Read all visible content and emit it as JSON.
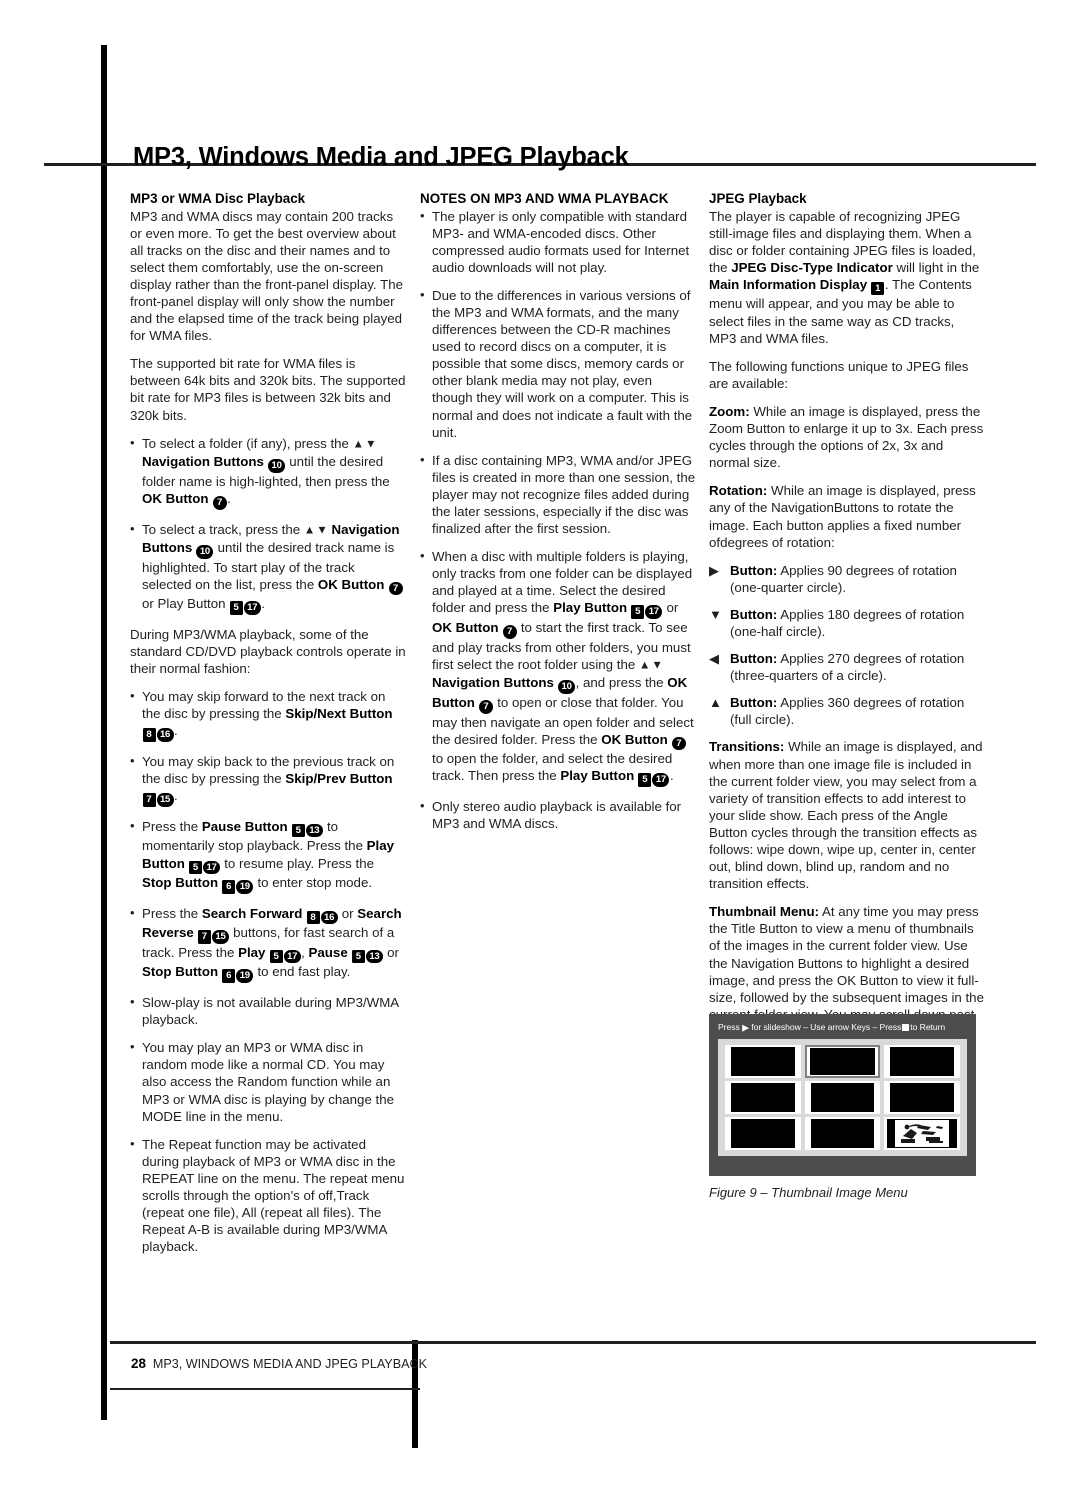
{
  "page": {
    "title": "MP3, Windows Media and JPEG Playback",
    "footer_page_number": "28",
    "footer_section": "MP3, WINDOWS MEDIA AND JPEG PLAYBACK"
  },
  "column1": {
    "heading": "MP3 or WMA Disc Playback",
    "p1": "MP3 and WMA discs may contain 200 tracks or even more. To get the best overview about all tracks on the disc and their names and to select them comfortably, use the on-screen display rather than the front-panel display. The front-panel display will only show the number and the elapsed time of the track being played for WMA files.",
    "p2": "The supported bit rate for WMA files is between 64k bits and 320k bits. The supported bit rate for MP3 files is between 32k bits and 320k bits.",
    "bullet1_a": "To select a folder (if any), press the ",
    "bullet1_b": "Navigation Buttons",
    "bullet1_c": " until the desired folder name is high-lighted, then press the ",
    "bullet1_d": "OK Button",
    "bullet1_e": ".",
    "bullet2_a": "To select a track, press the ",
    "bullet2_b": "Navigation Buttons",
    "bullet2_c": " until the desired track name is highlighted. To start play of the track selected on the list, press the ",
    "bullet2_d": "OK Button",
    "bullet2_e": " or Play Button ",
    "bullet2_f": ".",
    "p3": "During MP3/WMA playback, some of the standard CD/DVD playback controls operate in their normal fashion:",
    "bullet3_a": "You may skip forward to the next track on the disc by pressing the ",
    "bullet3_b": "Skip/Next Button",
    "bullet3_c": ".",
    "bullet4_a": "You may skip back to the previous track on the disc by pressing the ",
    "bullet4_b": "Skip/Prev Button",
    "bullet4_c": ".",
    "bullet5_a": "Press the ",
    "bullet5_b": "Pause Button",
    "bullet5_c": " to momentarily stop playback. Press the ",
    "bullet5_d": "Play Button",
    "bullet5_e": " to resume play. Press the ",
    "bullet5_f": "Stop Button",
    "bullet5_g": " to enter stop mode.",
    "bullet6_a": "Press the ",
    "bullet6_b": "Search Forward",
    "bullet6_c": " or ",
    "bullet6_d": "Search Reverse",
    "bullet6_e": " buttons, for fast search of a track. Press the ",
    "bullet6_f": "Play",
    "bullet6_g": ", ",
    "bullet6_h": "Pause",
    "bullet6_i": " or ",
    "bullet6_j": "Stop Button",
    "bullet6_k": " to end fast play.",
    "bullet7": "Slow-play is not available during MP3/WMA playback.",
    "bullet8": "You may play an MP3 or WMA disc in random mode like a normal CD. You may also access the Random function while an MP3 or WMA disc is playing by change the MODE line in the menu.",
    "bullet9_line1": "The Repeat function may be activated during playback of MP3 or WMA disc in the REPEAT line on the menu.",
    "bullet9_line2": "The repeat menu scrolls through the option's of off,Track (repeat one file), All (repeat all files).",
    "bullet9_line3": "The Repeat A-B is available during MP3/WMA playback."
  },
  "column2": {
    "heading": "NOTES ON MP3 AND WMA PLAYBACK",
    "bullet1": "The player is only compatible with standard MP3- and WMA-encoded discs. Other compressed audio formats used for Internet audio downloads will not play.",
    "bullet2": "Due to the differences in various versions of the MP3 and WMA formats, and the many differences between the CD-R machines used to record discs on a computer, it is possible that some discs, memory cards or other blank media may not play, even though they will work on a computer. This is normal and does not indicate a fault with the unit.",
    "bullet3": "If a disc containing MP3, WMA and/or JPEG files is created in more than one session, the player may not recognize files added during the later sessions, especially if the disc was finalized after the first session.",
    "bullet4_a": "When a disc with multiple folders is playing, only tracks from one folder can be displayed and played at a time. Select the desired folder and press the ",
    "bullet4_b": "Play Button",
    "bullet4_c": " or ",
    "bullet4_d": "OK Button",
    "bullet4_e": " to start the first track. To see and play tracks from other folders, you must first select the root folder using the ",
    "bullet4_f": "Navigation Buttons",
    "bullet4_g": ", and press the ",
    "bullet4_h": "OK Button",
    "bullet4_i": " to open or close that folder. You may then navigate an open folder and select the desired folder. Press the ",
    "bullet4_j": "OK Button",
    "bullet4_k": " to open the folder, and select the desired track. Then press the ",
    "bullet4_l": "Play Button",
    "bullet4_m": ".",
    "bullet5": "Only stereo audio playback is available for MP3 and WMA discs."
  },
  "column3": {
    "heading": "JPEG Playback",
    "p1_a": "The player is capable of recognizing JPEG still-image files and displaying them. When a disc or folder containing JPEG files is loaded, the ",
    "p1_b": "JPEG Disc-Type Indicator",
    "p1_c": " will light in the ",
    "p1_d": "Main Information Display",
    "p1_e": ". The Contents menu will appear, and you may be able to select files in the same way as CD tracks, MP3 and WMA files.",
    "p2": "The following functions unique to JPEG files are available:",
    "zoom_label": "Zoom:",
    "zoom_text": " While an image is displayed, press the Zoom Button to enlarge it up to 3x. Each press cycles through the options of 2x, 3x and normal size.",
    "rotation_label": "Rotation:",
    "rotation_text": " While an image is displayed, press any of the NavigationButtons to rotate the image. Each button applies a fixed number ofdegrees of rotation:",
    "rot_items": [
      {
        "arrow": "▶",
        "label": "Button:",
        "text": " Applies 90 degrees of rotation (one-quarter circle)."
      },
      {
        "arrow": "▼",
        "label": "Button:",
        "text": " Applies 180 degrees of rotation (one-half circle)."
      },
      {
        "arrow": "◀",
        "label": "Button:",
        "text": " Applies 270 degrees of rotation (three-quarters of a circle)."
      },
      {
        "arrow": "▲",
        "label": "Button:",
        "text": " Applies 360 degrees of rotation (full circle)."
      }
    ],
    "transitions_label": "Transitions:",
    "transitions_text": " While an image is displayed, and when more than one image file is included in the current folder view, you may select from a variety of transition effects to add interest to your slide show. Each press of the Angle Button cycles through the transition effects as follows: wipe down, wipe up, center in, center out, blind down, blind up, random and no transition effects.",
    "thumbnail_label": "Thumbnail Menu:",
    "thumbnail_text": " At any time you may press the Title Button to view a menu of thumbnails of the images in the current folder view. Use the Navigation Buttons to highlight a desired image, and press the OK Button to view it full-size, followed by the subsequent images in the current folder view. You may scroll down past the first nine images shown on screen. Press the Stop Button to return to the Contents Menu."
  },
  "figure": {
    "banner_part1": "Press ",
    "banner_play_glyph": "▶",
    "banner_part2": " for slideshow – Use arrow Keys – Press",
    "banner_part3": "to Return",
    "caption": "Figure 9 – Thumbnail Image Menu",
    "thumbnail_count": "9",
    "selected_thumbnail_index": "2"
  },
  "badges": {
    "b1": "1",
    "b5": "5",
    "b6": "6",
    "b7": "7",
    "b8": "8",
    "b10": "10",
    "b13": "13",
    "b15": "15",
    "b16": "16",
    "b17": "17",
    "b19": "19"
  },
  "colors": {
    "text": "#231f20",
    "rule": "#000000",
    "figure_bg": "#4d4d4d",
    "figure_panel": "#d9d9d9"
  }
}
